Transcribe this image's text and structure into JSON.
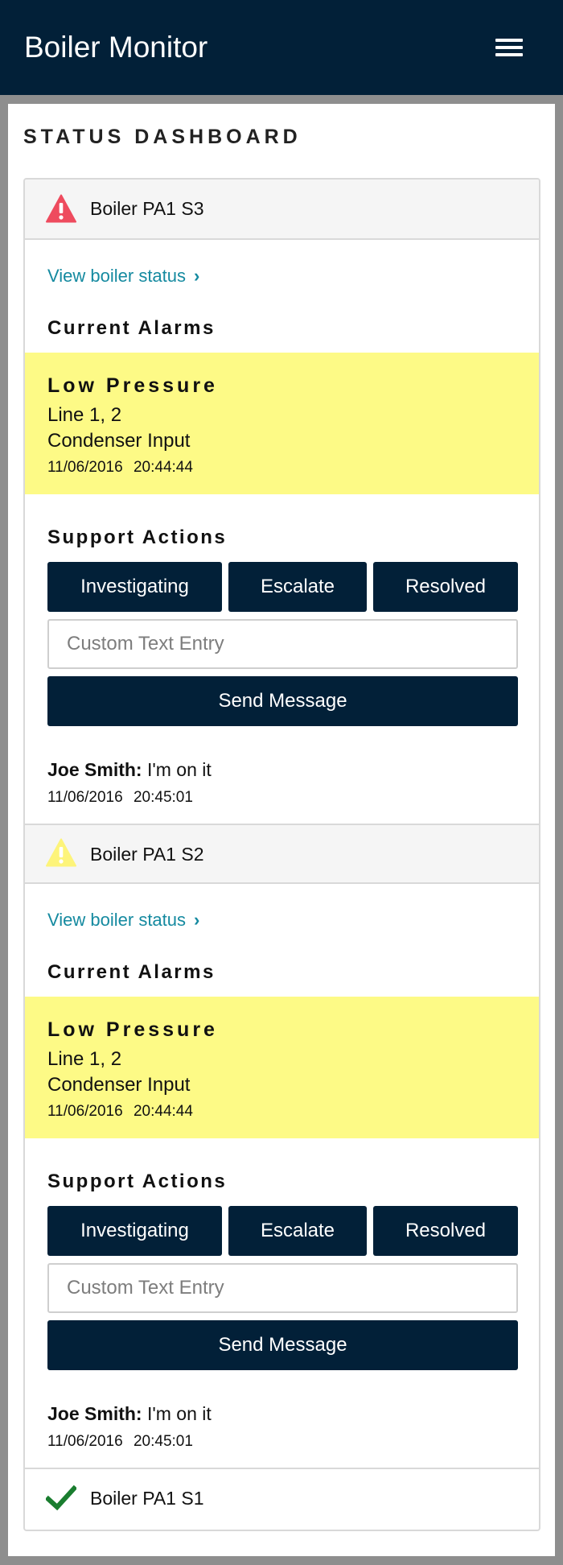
{
  "header": {
    "title": "Boiler Monitor",
    "menu_icon": "hamburger-menu-icon"
  },
  "page_title": "STATUS DASHBOARD",
  "colors": {
    "navy": "#022038",
    "alarm_bg": "#fdfa86",
    "link": "#158aa0",
    "critical": "#ee4b5e",
    "warning": "#fdf47a",
    "ok": "#1a7d2f"
  },
  "boilers": [
    {
      "name": "Boiler PA1 S3",
      "status_icon": "alert-triangle-critical-icon",
      "view_link": "View boiler status",
      "alarms_heading": "Current Alarms",
      "alarm": {
        "title": "Low Pressure",
        "line1": "Line 1, 2",
        "line2": "Condenser Input",
        "time": "11/06/2016 20:44:44"
      },
      "actions_heading": "Support Actions",
      "actions": [
        "Investigating",
        "Escalate",
        "Resolved"
      ],
      "text_placeholder": "Custom Text Entry",
      "send_label": "Send Message",
      "message": {
        "author": "Joe Smith:",
        "text": "I'm on it",
        "time": "11/06/2016 20:45:01"
      }
    },
    {
      "name": "Boiler PA1 S2",
      "status_icon": "alert-triangle-warning-icon",
      "view_link": "View boiler status",
      "alarms_heading": "Current Alarms",
      "alarm": {
        "title": "Low Pressure",
        "line1": "Line 1, 2",
        "line2": "Condenser Input",
        "time": "11/06/2016 20:44:44"
      },
      "actions_heading": "Support Actions",
      "actions": [
        "Investigating",
        "Escalate",
        "Resolved"
      ],
      "text_placeholder": "Custom Text Entry",
      "send_label": "Send Message",
      "message": {
        "author": "Joe Smith:",
        "text": "I'm on it",
        "time": "11/06/2016 20:45:01"
      }
    },
    {
      "name": "Boiler PA1 S1",
      "status_icon": "check-ok-icon"
    }
  ]
}
